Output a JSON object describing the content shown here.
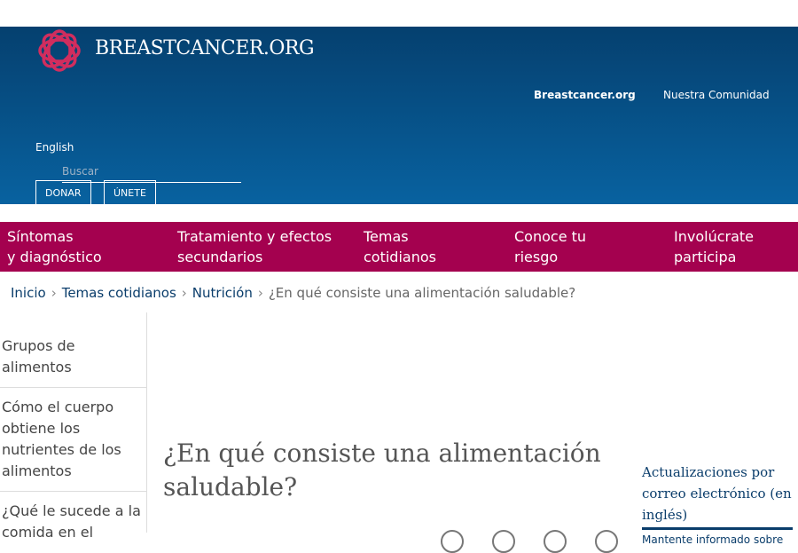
{
  "header": {
    "logo_text": "BREASTCANCER.ORG",
    "links": [
      "Breastcancer.org",
      "Nuestra Comunidad"
    ],
    "language": "English",
    "search_placeholder": "Buscar",
    "donate": "DONAR",
    "join": "ÚNETE"
  },
  "nav": [
    [
      "Síntomas",
      "y diagnóstico"
    ],
    [
      "Tratamiento y efectos",
      "secundarios"
    ],
    [
      "Temas",
      "cotidianos"
    ],
    [
      "Conoce tu",
      "riesgo"
    ],
    [
      "Involúcrate",
      "participa"
    ]
  ],
  "breadcrumb": [
    "Inicio",
    "Temas cotidianos",
    "Nutrición",
    "¿En qué consiste una alimentación saludable?"
  ],
  "sidebar": [
    "Grupos de alimentos",
    "Cómo el cuerpo obtiene los nutrientes de los alimentos",
    "¿Qué le sucede a la comida en el"
  ],
  "main": {
    "title": "¿En qué consiste una alimentación saludable?"
  },
  "aside": {
    "title": "Actualizaciones por correo electrónico (en inglés)",
    "text": "Mantente informado sobre"
  },
  "colors": {
    "header": "#05406f",
    "nav": "#a4014f",
    "accent": "#0a3d6b"
  }
}
